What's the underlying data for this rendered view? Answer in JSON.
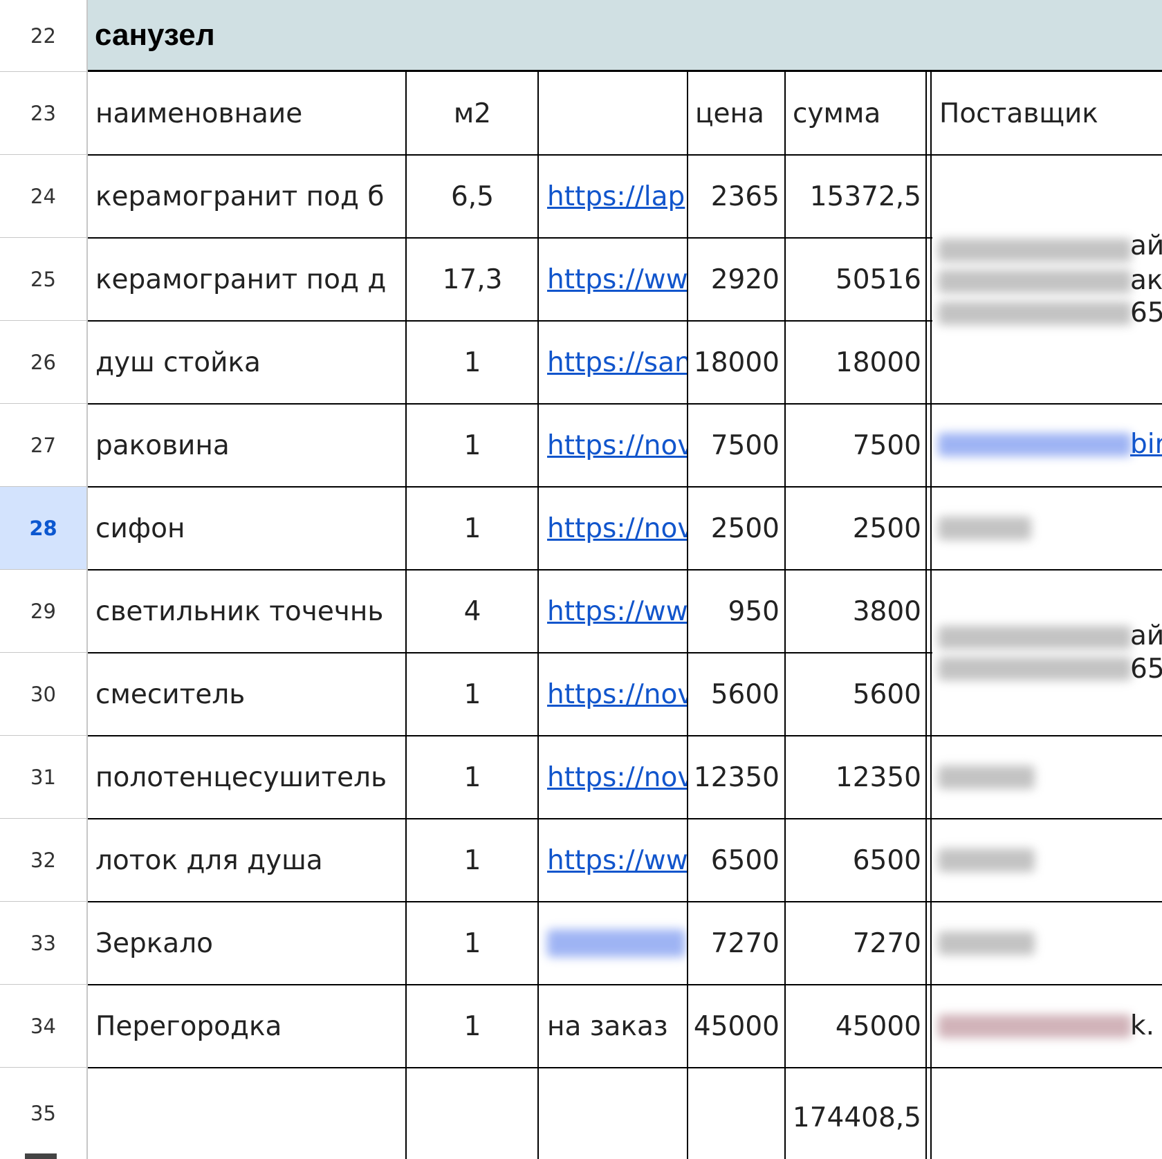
{
  "section": {
    "title": "санузел"
  },
  "row_numbers": [
    "22",
    "23",
    "24",
    "25",
    "26",
    "27",
    "28",
    "29",
    "30",
    "31",
    "32",
    "33",
    "34",
    "35"
  ],
  "selected_row": "28",
  "header": {
    "name": "наименовнаие",
    "qty": "м2",
    "link": "",
    "price": "цена",
    "sum": "сумма",
    "supplier": "Поставщик"
  },
  "rows": [
    {
      "name": "керамогранит под б",
      "qty": "6,5",
      "link": "https://lap",
      "price": "2365",
      "sum": "15372,5"
    },
    {
      "name": "керамогранит под д",
      "qty": "17,3",
      "link": "https://ww",
      "price": "2920",
      "sum": "50516"
    },
    {
      "name": "душ стойка",
      "qty": "1",
      "link": "https://san",
      "price": "18000",
      "sum": "18000"
    },
    {
      "name": "раковина",
      "qty": "1",
      "link": "https://nov",
      "price": "7500",
      "sum": "7500"
    },
    {
      "name": "сифон",
      "qty": "1",
      "link": "https://nov",
      "price": "2500",
      "sum": "2500"
    },
    {
      "name": "светильник точечнь",
      "qty": "4",
      "link": "https://ww",
      "price": "950",
      "sum": "3800"
    },
    {
      "name": "смеситель",
      "qty": "1",
      "link": "https://nov",
      "price": "5600",
      "sum": "5600"
    },
    {
      "name": "полотенцесушитель",
      "qty": "1",
      "link": "https://nov",
      "price": "12350",
      "sum": "12350"
    },
    {
      "name": "лоток для душа",
      "qty": "1",
      "link": "https://ww",
      "price": "6500",
      "sum": "6500"
    },
    {
      "name": "Зеркало",
      "qty": "1",
      "link": "",
      "price": "7270",
      "sum": "7270"
    },
    {
      "name": "Перегородка",
      "qty": "1",
      "link_text": "на заказ",
      "price": "45000",
      "sum": "45000"
    }
  ],
  "total": {
    "sum": "174408,5"
  },
  "supplier_fragments": {
    "group1_line1": "ай",
    "group1_line2": "ако",
    "group1_line3": "65",
    "raskovina_link": "bir",
    "group2_line1": "ай",
    "group2_line2": "65",
    "peregorodka": "k."
  },
  "colors": {
    "section_bg": "#d0e0e3",
    "link": "#1155cc",
    "selected_row_bg": "#d3e3fd"
  }
}
